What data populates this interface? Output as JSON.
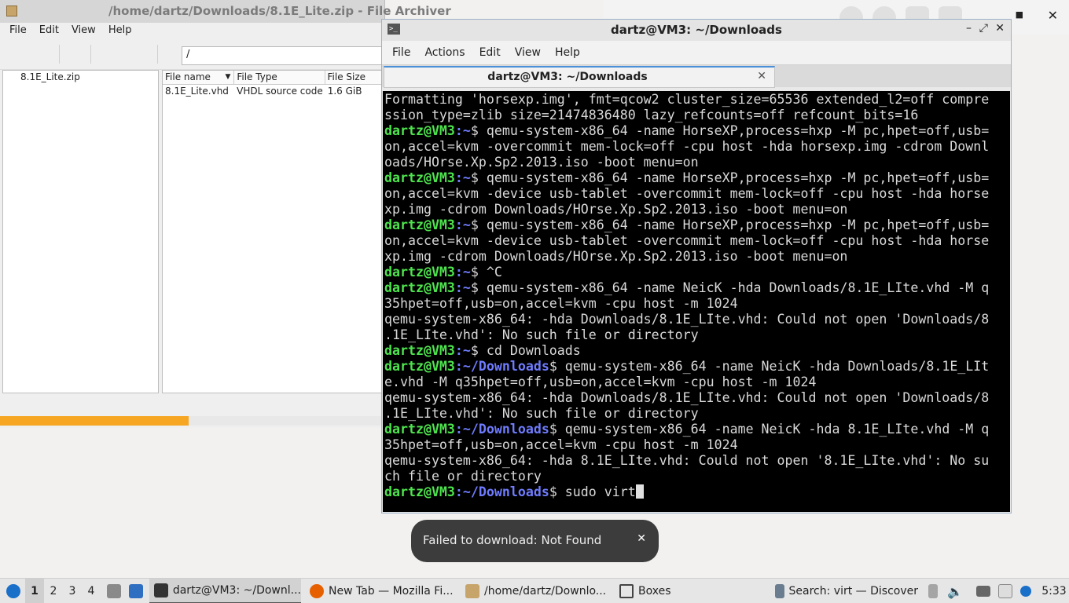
{
  "file_archiver": {
    "title": "/home/dartz/Downloads/8.1E_Lite.zip - File Archiver",
    "menu": [
      "File",
      "Edit",
      "View",
      "Help"
    ],
    "path": "/",
    "tree_item": "8.1E_Lite.zip",
    "columns": [
      "File name",
      "File Type",
      "File Size"
    ],
    "rows": [
      {
        "name": "8.1E_Lite.vhd",
        "type": "VHDL source code",
        "size": "1.6 GiB"
      }
    ],
    "progress_fraction": 0.49
  },
  "terminal": {
    "title": "dartz@VM3: ~/Downloads",
    "menu": [
      "File",
      "Actions",
      "Edit",
      "View",
      "Help"
    ],
    "tab_label": "dartz@VM3: ~/Downloads",
    "lines": [
      {
        "text": "Formatting 'horsexp.img', fmt=qcow2 cluster_size=65536 extended_l2=off compre"
      },
      {
        "text": "ssion_type=zlib size=21474836480 lazy_refcounts=off refcount_bits=16"
      },
      {
        "user": "dartz@VM3",
        "path": ":~",
        "text": "$ qemu-system-x86_64 -name HorseXP,process=hxp -M pc,hpet=off,usb="
      },
      {
        "text": "on,accel=kvm -overcommit mem-lock=off -cpu host -hda horsexp.img -cdrom Downl"
      },
      {
        "text": "oads/HOrse.Xp.Sp2.2013.iso -boot menu=on"
      },
      {
        "user": "dartz@VM3",
        "path": ":~",
        "text": "$ qemu-system-x86_64 -name HorseXP,process=hxp -M pc,hpet=off,usb="
      },
      {
        "text": "on,accel=kvm -device usb-tablet -overcommit mem-lock=off -cpu host -hda horse"
      },
      {
        "text": "xp.img -cdrom Downloads/HOrse.Xp.Sp2.2013.iso -boot menu=on"
      },
      {
        "user": "dartz@VM3",
        "path": ":~",
        "text": "$ qemu-system-x86_64 -name HorseXP,process=hxp -M pc,hpet=off,usb="
      },
      {
        "text": "on,accel=kvm -device usb-tablet -overcommit mem-lock=off -cpu host -hda horse"
      },
      {
        "text": "xp.img -cdrom Downloads/HOrse.Xp.Sp2.2013.iso -boot menu=on"
      },
      {
        "user": "dartz@VM3",
        "path": ":~",
        "text": "$ ^C"
      },
      {
        "user": "dartz@VM3",
        "path": ":~",
        "text": "$ qemu-system-x86_64 -name NeicK -hda Downloads/8.1E_LIte.vhd -M q"
      },
      {
        "text": "35hpet=off,usb=on,accel=kvm -cpu host -m 1024"
      },
      {
        "text": "qemu-system-x86_64: -hda Downloads/8.1E_LIte.vhd: Could not open 'Downloads/8"
      },
      {
        "text": ".1E_LIte.vhd': No such file or directory"
      },
      {
        "user": "dartz@VM3",
        "path": ":~",
        "text": "$ cd Downloads"
      },
      {
        "user": "dartz@VM3",
        "path": ":~/Downloads",
        "text": "$ qemu-system-x86_64 -name NeicK -hda Downloads/8.1E_LIt"
      },
      {
        "text": "e.vhd -M q35hpet=off,usb=on,accel=kvm -cpu host -m 1024"
      },
      {
        "text": "qemu-system-x86_64: -hda Downloads/8.1E_LIte.vhd: Could not open 'Downloads/8"
      },
      {
        "text": ".1E_LIte.vhd': No such file or directory"
      },
      {
        "user": "dartz@VM3",
        "path": ":~/Downloads",
        "text": "$ qemu-system-x86_64 -name NeicK -hda 8.1E_LIte.vhd -M q"
      },
      {
        "text": "35hpet=off,usb=on,accel=kvm -cpu host -m 1024"
      },
      {
        "text": "qemu-system-x86_64: -hda 8.1E_LIte.vhd: Could not open '8.1E_LIte.vhd': No su"
      },
      {
        "text": "ch file or directory"
      },
      {
        "user": "dartz@VM3",
        "path": ":~/Downloads",
        "text": "$ sudo virt",
        "cursor": true
      }
    ],
    "colors": {
      "user": "#4ee44e",
      "path": "#6f7cff",
      "background": "#000000",
      "text": "#d9d9d9"
    }
  },
  "notification": {
    "message": "Failed to download: Not Found",
    "close_icon": "close-icon"
  },
  "taskbar": {
    "workspaces": [
      "1",
      "2",
      "3",
      "4"
    ],
    "tasks": [
      {
        "label": "dartz@VM3: ~/Downl...",
        "icon": "terminal-icon"
      },
      {
        "label": "New Tab — Mozilla Fi...",
        "icon": "firefox-icon"
      },
      {
        "label": "/home/dartz/Downlo...",
        "icon": "archive-icon"
      },
      {
        "label": "Boxes",
        "icon": "boxes-icon"
      },
      {
        "label": "Search: virt — Discover",
        "icon": "discover-icon"
      }
    ],
    "clock": "5:33"
  }
}
